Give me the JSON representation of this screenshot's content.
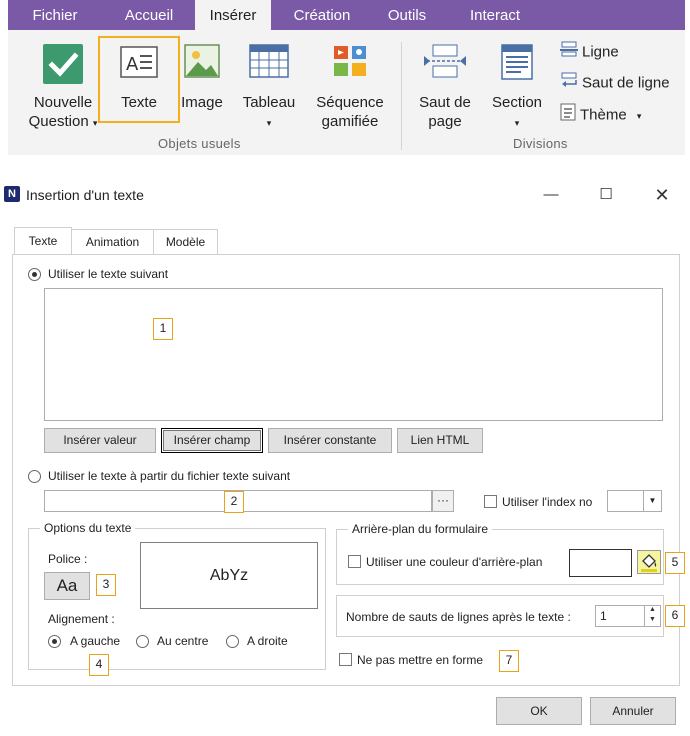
{
  "ribbon": {
    "tabs": [
      "Fichier",
      "Accueil",
      "Insérer",
      "Création",
      "Outils",
      "Interact"
    ],
    "active_tab": "Insérer",
    "buttons": {
      "nouvelle_question": [
        "Nouvelle",
        "Question"
      ],
      "texte": "Texte",
      "image": "Image",
      "tableau": "Tableau",
      "sequence": [
        "Séquence",
        "gamifiée"
      ],
      "saut_de_page": [
        "Saut de",
        "page"
      ],
      "section": "Section"
    },
    "small_buttons": [
      "Ligne",
      "Saut de ligne",
      "Thème"
    ],
    "groups": [
      "Objets usuels",
      "Divisions"
    ],
    "colors": {
      "tab_bar": "#7a5aa6",
      "highlight": "#f2b01e"
    }
  },
  "dialog": {
    "title": "Insertion d'un texte",
    "window_controls": [
      "minimize-icon",
      "maximize-icon",
      "close-icon"
    ],
    "tabs": [
      "Texte",
      "Animation",
      "Modèle"
    ],
    "active_tab": "Texte",
    "option_text_label": "Utiliser le texte suivant",
    "option_file_label": "Utiliser le texte à partir du fichier texte suivant",
    "text_buttons": [
      "Insérer valeur",
      "Insérer champ",
      "Insérer constante",
      "Lien HTML"
    ],
    "browse_button": "···",
    "index_label": "Utiliser l'index no",
    "options_group": {
      "title": "Options du texte",
      "police_label": "Police :",
      "font_button": "Aa",
      "preview": "AbYz",
      "alignment_label": "Alignement :",
      "alignments": [
        "A gauche",
        "Au centre",
        "A droite"
      ],
      "selected_alignment": "A gauche"
    },
    "background_group": {
      "title": "Arrière-plan du formulaire",
      "use_color_label": "Utiliser une couleur d'arrière-plan"
    },
    "line_breaks_label": "Nombre de sauts de lignes après le texte :",
    "line_breaks_value": "1",
    "no_format_label": "Ne pas mettre en forme",
    "ok_button": "OK",
    "cancel_button": "Annuler",
    "callouts": [
      "1",
      "2",
      "3",
      "4",
      "5",
      "6",
      "7"
    ]
  }
}
